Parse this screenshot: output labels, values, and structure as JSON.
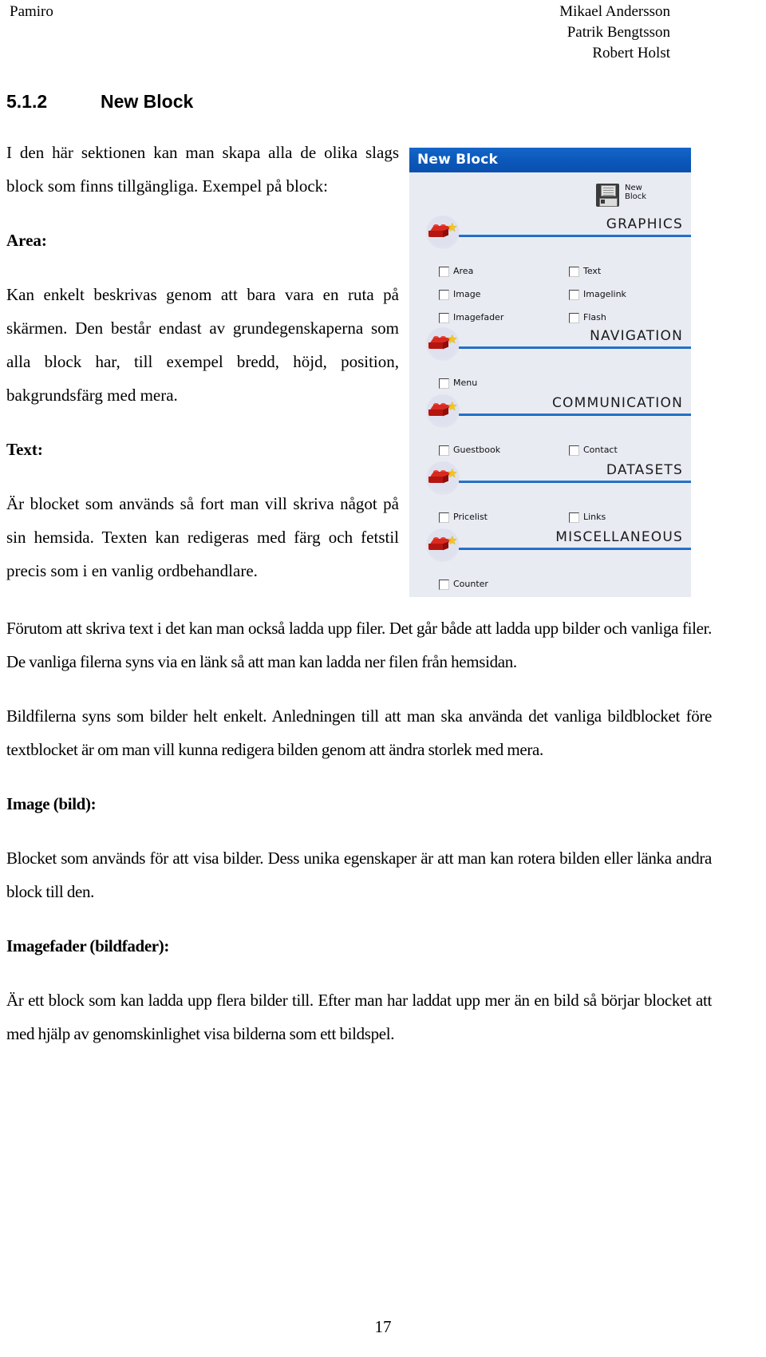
{
  "header": {
    "left": "Pamiro",
    "authors": [
      "Mikael Andersson",
      "Patrik Bengtsson",
      "Robert Holst"
    ]
  },
  "section": {
    "number": "5.1.2",
    "title": "New Block"
  },
  "narrow_column": {
    "intro": "I den här sektionen kan man skapa alla de olika slags block som finns tillgängliga. Exempel på block:",
    "area_heading": "Area:",
    "area_body": "Kan enkelt beskrivas genom att bara vara en ruta på skärmen. Den består endast av grundegenskaperna som alla block har, till exempel bredd, höjd, position, bakgrundsfärg med mera.",
    "text_heading": "Text:",
    "text_body": "Är blocket som används så fort man vill skriva något på sin hemsida. Texten kan redigeras med färg och fetstil precis som i en vanlig ordbehandlare."
  },
  "wide_column": {
    "para1": "Förutom att skriva text i det kan man också ladda upp filer. Det går både att ladda upp bilder och vanliga filer. De vanliga filerna syns via en länk så att man kan ladda ner filen från hemsidan.",
    "para2": "Bildfilerna syns som bilder helt enkelt. Anledningen till att man ska använda det vanliga bildblocket före textblocket är om man vill kunna redigera bilden genom att ändra storlek med mera.",
    "image_heading": "Image (bild):",
    "image_body": "Blocket som används för att visa bilder. Dess unika egenskaper är att man kan rotera bilden eller länka andra block till den.",
    "imagefader_heading": "Imagefader (bildfader):",
    "imagefader_body": "Är ett block som kan ladda upp flera bilder till. Efter man har laddat upp mer än en bild så börjar blocket att med hjälp av genomskinlighet visa bilderna som ett bildspel."
  },
  "figure": {
    "window_title": "New Block",
    "new_block_button": {
      "line1": "New",
      "line2": "Block"
    },
    "categories": [
      {
        "name": "GRAPHICS",
        "options": [
          {
            "label": "Area",
            "col": 0,
            "row": 0
          },
          {
            "label": "Text",
            "col": 1,
            "row": 0
          },
          {
            "label": "Image",
            "col": 0,
            "row": 1
          },
          {
            "label": "Imagelink",
            "col": 1,
            "row": 1
          },
          {
            "label": "Imagefader",
            "col": 0,
            "row": 2
          },
          {
            "label": "Flash",
            "col": 1,
            "row": 2
          }
        ]
      },
      {
        "name": "NAVIGATION",
        "options": [
          {
            "label": "Menu",
            "col": 0,
            "row": 0
          }
        ]
      },
      {
        "name": "COMMUNICATION",
        "options": [
          {
            "label": "Guestbook",
            "col": 0,
            "row": 0
          },
          {
            "label": "Contact",
            "col": 1,
            "row": 0
          }
        ]
      },
      {
        "name": "DATASETS",
        "options": [
          {
            "label": "Pricelist",
            "col": 0,
            "row": 0
          },
          {
            "label": "Links",
            "col": 1,
            "row": 0
          }
        ]
      },
      {
        "name": "MISCELLANEOUS",
        "options": [
          {
            "label": "Counter",
            "col": 0,
            "row": 0
          }
        ]
      }
    ],
    "colors": {
      "titlebar": "#0b57ba",
      "panel": "#e9ebf3",
      "rule": "#1a62b8",
      "brick": "#d92a21",
      "star": "#f5c518"
    }
  },
  "page_number": "17"
}
